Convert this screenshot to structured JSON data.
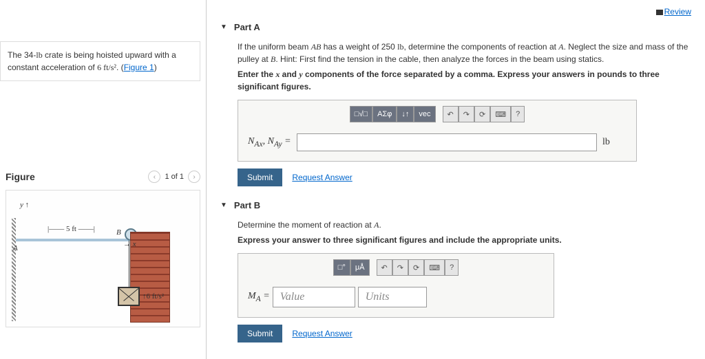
{
  "review": "Review",
  "problem": {
    "text1": "The 34-",
    "unit1": "lb",
    "text2": " crate is being hoisted upward with a constant acceleration of ",
    "val2": "6 ft/s²",
    "text3": ". (",
    "link": "Figure 1",
    "text4": ")"
  },
  "figure": {
    "title": "Figure",
    "nav": "1 of 1",
    "dim": "5 ft",
    "A": "A",
    "B": "B",
    "x": "x",
    "y": "y",
    "accel": "6 ft/s²"
  },
  "partA": {
    "title": "Part A",
    "instr1a": "If the uniform beam ",
    "instr1b": "AB",
    "instr1c": " has a weight of 250 ",
    "instr1d": "lb",
    "instr1e": ", determine the components of reaction at ",
    "instr1f": "A",
    "instr1g": ". Neglect the size and mass of the pulley at ",
    "instr1h": "B",
    "instr1i": ". Hint: First find the tension in the cable, then analyze the forces in the beam using statics.",
    "instr2a": "Enter the ",
    "instr2b": "x",
    "instr2c": " and ",
    "instr2d": "y",
    "instr2e": " components of the force separated by a comma. Express your answers in pounds to three significant figures.",
    "label": "N_Ax, N_Ay =",
    "unit": "lb",
    "tb": {
      "frac": "□√□",
      "greek": "ΑΣφ",
      "sub": "↓↑",
      "vec": "vec",
      "undo": "↶",
      "redo": "↷",
      "reset": "⟳",
      "kb": "⌨",
      "help": "?"
    }
  },
  "partB": {
    "title": "Part B",
    "instr1a": "Determine the moment of reaction at ",
    "instr1b": "A",
    "instr1c": ".",
    "instr2": "Express your answer to three significant figures and include the appropriate units.",
    "label": "M_A =",
    "value_ph": "Value",
    "units_ph": "Units",
    "tb": {
      "frac": "□°",
      "units": "μÅ",
      "undo": "↶",
      "redo": "↷",
      "reset": "⟳",
      "kb": "⌨",
      "help": "?"
    }
  },
  "submit": "Submit",
  "request": "Request Answer"
}
